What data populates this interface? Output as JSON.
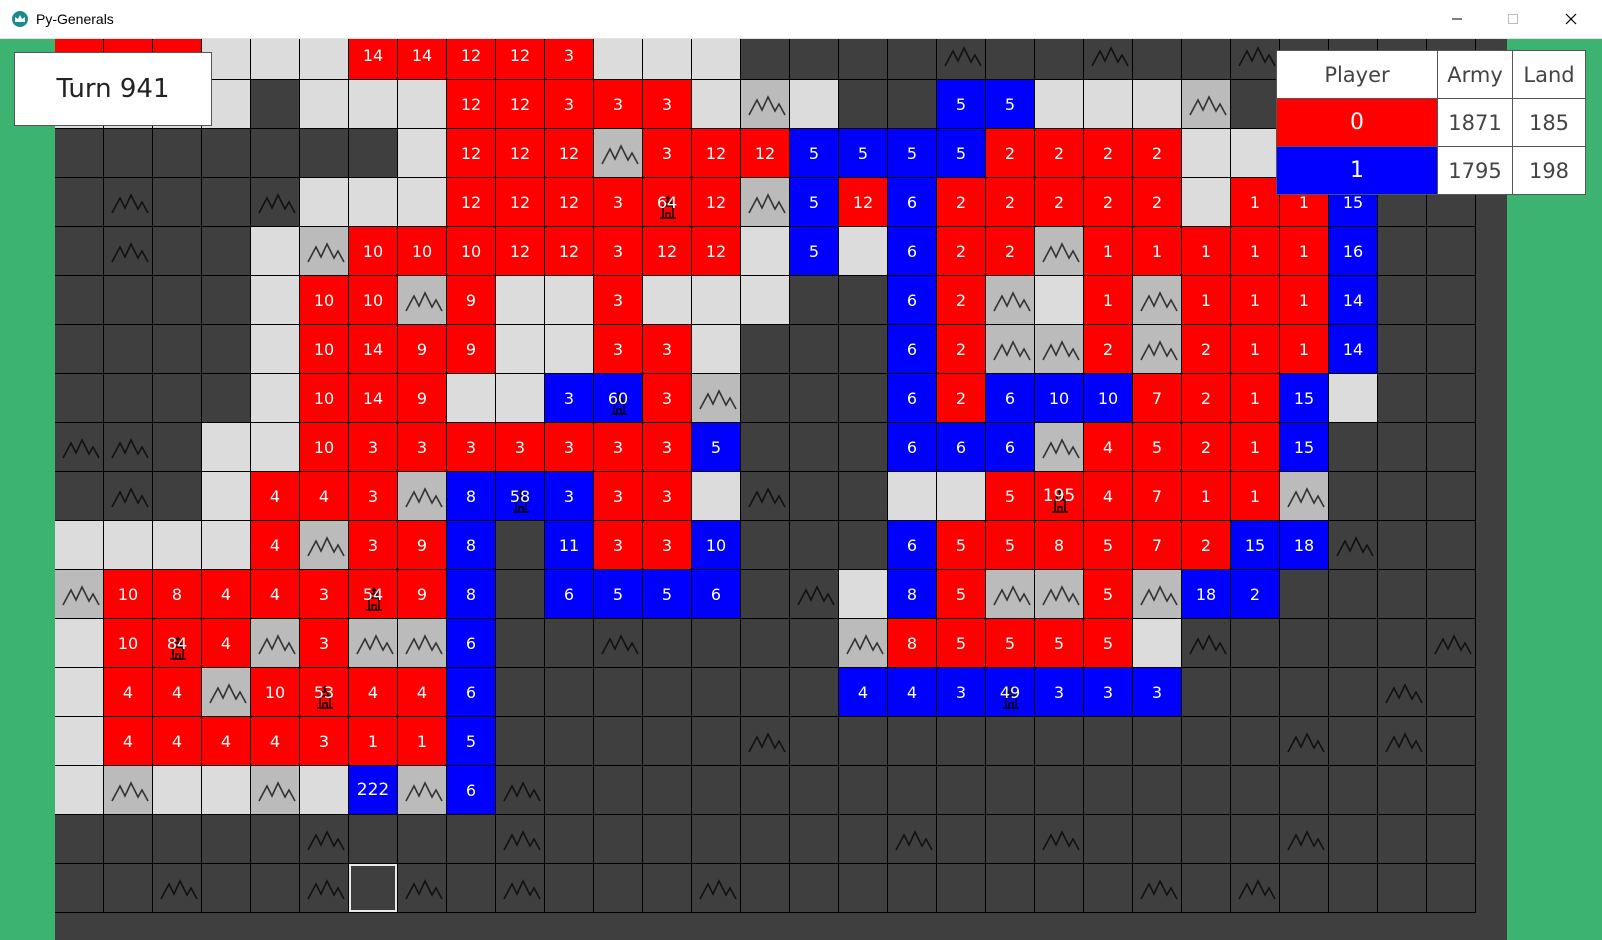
{
  "window": {
    "title": "Py-Generals",
    "controls": {
      "minimize": "minimize-icon",
      "maximize": "maximize-icon",
      "close": "close-icon"
    }
  },
  "turn_label": "Turn 941",
  "leaderboard": {
    "headers": [
      "Player",
      "Army",
      "Land"
    ],
    "rows": [
      {
        "player": "0",
        "army": "1871",
        "land": "185",
        "color": "#ff0000"
      },
      {
        "player": "1",
        "army": "1795",
        "land": "198",
        "color": "#0000ff"
      }
    ]
  },
  "colors": {
    "fog": "#3f3f3f",
    "empty": "#dcdcdc",
    "red": "#ff0000",
    "blue": "#0000ff",
    "mountain": "#bbbbbb",
    "background": "#3cb371"
  },
  "legend": {
    "F": "fog",
    "E": "empty",
    "R": "red",
    "B": "blue",
    "M": "mountain",
    "N": "fog-mountain",
    "H": "highlight"
  },
  "grid": {
    "rows": [
      [
        "R",
        "R",
        "R",
        "E",
        "E",
        "E",
        "R:14",
        "R:14",
        "R:12",
        "R:12",
        "R:3",
        "E",
        "E",
        "E",
        "F",
        "F",
        "F",
        "F",
        "N",
        "F",
        "F",
        "N",
        "F",
        "F",
        "N",
        "F",
        "F",
        "F",
        "F"
      ],
      [
        "E",
        "E",
        "E",
        "E",
        "F",
        "E",
        "E",
        "E",
        "R:12",
        "R:12",
        "R:3",
        "R:3",
        "R:3",
        "E",
        "M",
        "E",
        "F",
        "F",
        "B:5",
        "B:5",
        "E",
        "E",
        "E",
        "M",
        "F",
        "F",
        "F",
        "F",
        "F"
      ],
      [
        "F",
        "F",
        "F",
        "F",
        "F",
        "F",
        "F",
        "E",
        "R:12",
        "R:12",
        "R:12",
        "M",
        "R:3",
        "R:12",
        "R:12",
        "B:5",
        "B:5",
        "B:5",
        "B:5",
        "R:2",
        "R:2",
        "R:2",
        "R:2",
        "E",
        "E",
        "F",
        "F",
        "F",
        "F"
      ],
      [
        "F",
        "N",
        "F",
        "F",
        "N",
        "E",
        "E",
        "E",
        "R:12",
        "R:12",
        "R:12",
        "R:3",
        "R:64:c",
        "R:12",
        "M",
        "B:5",
        "R:12",
        "B:6",
        "R:2",
        "R:2",
        "R:2",
        "R:2",
        "R:2",
        "E",
        "R:1",
        "R:1",
        "B:15",
        "F",
        "F"
      ],
      [
        "F",
        "N",
        "F",
        "F",
        "E",
        "M",
        "R:10",
        "R:10",
        "R:10",
        "R:12",
        "R:12",
        "R:3",
        "R:12",
        "R:12",
        "E",
        "B:5",
        "E",
        "B:6",
        "R:2",
        "R:2",
        "M",
        "R:1",
        "R:1",
        "R:1",
        "R:1",
        "R:1",
        "B:16",
        "F",
        "F"
      ],
      [
        "F",
        "F",
        "F",
        "F",
        "E",
        "R:10",
        "R:10",
        "M",
        "R:9",
        "E",
        "E",
        "R:3",
        "E",
        "E",
        "E",
        "F",
        "F",
        "B:6",
        "R:2",
        "M",
        "E",
        "R:1",
        "M",
        "R:1",
        "R:1",
        "R:1",
        "B:14",
        "F",
        "F"
      ],
      [
        "F",
        "F",
        "F",
        "F",
        "E",
        "R:10",
        "R:14",
        "R:9",
        "R:9",
        "E",
        "E",
        "R:3",
        "R:3",
        "E",
        "F",
        "F",
        "F",
        "B:6",
        "R:2",
        "M",
        "M",
        "R:2",
        "M",
        "R:2",
        "R:1",
        "R:1",
        "B:14",
        "F",
        "F"
      ],
      [
        "F",
        "F",
        "F",
        "F",
        "E",
        "R:10",
        "R:14",
        "R:9",
        "E",
        "E",
        "B:3",
        "B:60:c",
        "R:3",
        "M",
        "F",
        "F",
        "F",
        "B:6",
        "R:2",
        "B:6",
        "B:10",
        "B:10",
        "R:7",
        "R:2",
        "R:1",
        "B:15",
        "E",
        "F",
        "F"
      ],
      [
        "N",
        "N",
        "F",
        "E",
        "E",
        "R:10",
        "R:3",
        "R:3",
        "R:3",
        "R:3",
        "R:3",
        "R:3",
        "R:3",
        "B:5",
        "F",
        "F",
        "F",
        "B:6",
        "B:6",
        "B:6",
        "M",
        "R:4",
        "R:5",
        "R:2",
        "R:1",
        "B:15",
        "F",
        "F",
        "F"
      ],
      [
        "F",
        "N",
        "F",
        "E",
        "R:4",
        "R:4",
        "R:3",
        "M",
        "B:8",
        "B:58:c",
        "B:3",
        "R:3",
        "R:3",
        "E",
        "N",
        "F",
        "F",
        "E",
        "E",
        "R:5",
        "R:195:c",
        "R:4",
        "R:7",
        "R:1",
        "R:1",
        "M",
        "F",
        "F",
        "F"
      ],
      [
        "E",
        "E",
        "E",
        "E",
        "R:4",
        "M",
        "R:3",
        "R:9",
        "B:8",
        "F",
        "B:11",
        "R:3",
        "R:3",
        "B:10",
        "F",
        "F",
        "F",
        "B:6",
        "R:5",
        "R:5",
        "R:8",
        "R:5",
        "R:7",
        "R:2",
        "B:15",
        "B:18",
        "N",
        "F",
        "F"
      ],
      [
        "M",
        "R:10",
        "R:8",
        "R:4",
        "R:4",
        "R:3",
        "R:54:c",
        "R:9",
        "B:8",
        "F",
        "B:6",
        "B:5",
        "B:5",
        "B:6",
        "F",
        "N",
        "E",
        "B:8",
        "R:5",
        "M",
        "M",
        "R:5",
        "M",
        "B:18",
        "B:2",
        "F",
        "F",
        "F",
        "F"
      ],
      [
        "E",
        "R:10",
        "R:84:c",
        "R:4",
        "M",
        "R:3",
        "M",
        "M",
        "B:6",
        "F",
        "F",
        "N",
        "F",
        "F",
        "F",
        "F",
        "M",
        "R:8",
        "R:5",
        "R:5",
        "R:5",
        "R:5",
        "E",
        "N",
        "F",
        "F",
        "F",
        "F",
        "N"
      ],
      [
        "E",
        "R:4",
        "R:4",
        "M",
        "R:10",
        "R:53:c",
        "R:4",
        "R:4",
        "B:6",
        "F",
        "F",
        "F",
        "F",
        "F",
        "F",
        "F",
        "B:4",
        "B:4",
        "B:3",
        "B:49:c",
        "B:3",
        "B:3",
        "B:3",
        "F",
        "F",
        "F",
        "F",
        "N",
        "F"
      ],
      [
        "E",
        "R:4",
        "R:4",
        "R:4",
        "R:4",
        "R:3",
        "R:1",
        "R:1",
        "B:5",
        "F",
        "F",
        "F",
        "F",
        "F",
        "N",
        "F",
        "F",
        "F",
        "F",
        "F",
        "F",
        "F",
        "F",
        "F",
        "F",
        "N",
        "F",
        "N",
        "F"
      ],
      [
        "E",
        "M",
        "E",
        "E",
        "M",
        "E",
        "B:222",
        "M",
        "B:6",
        "N",
        "F",
        "F",
        "F",
        "F",
        "F",
        "F",
        "F",
        "F",
        "F",
        "F",
        "F",
        "F",
        "F",
        "F",
        "F",
        "F",
        "F",
        "F",
        "F"
      ],
      [
        "F",
        "F",
        "F",
        "F",
        "F",
        "N",
        "F",
        "F",
        "F",
        "N",
        "F",
        "F",
        "F",
        "F",
        "F",
        "F",
        "F",
        "N",
        "F",
        "F",
        "N",
        "F",
        "F",
        "F",
        "F",
        "N",
        "F",
        "F",
        "F"
      ],
      [
        "F",
        "F",
        "N",
        "F",
        "F",
        "N",
        "H",
        "N",
        "F",
        "N",
        "F",
        "F",
        "F",
        "N",
        "F",
        "F",
        "F",
        "F",
        "F",
        "F",
        "F",
        "F",
        "N",
        "F",
        "N",
        "F",
        "F",
        "F",
        "F"
      ]
    ]
  }
}
